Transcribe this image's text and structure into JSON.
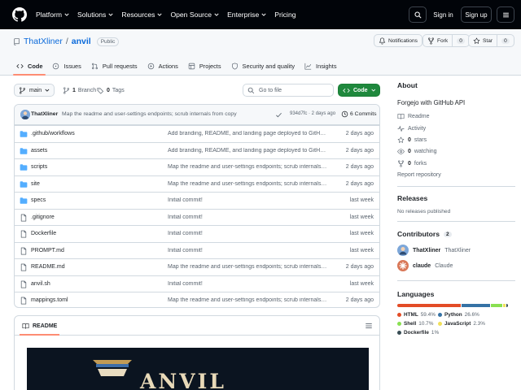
{
  "topbar": {
    "nav": [
      "Platform",
      "Solutions",
      "Resources",
      "Open Source",
      "Enterprise",
      "Pricing"
    ],
    "signin": "Sign in",
    "signup": "Sign up"
  },
  "repo": {
    "owner": "ThatXliner",
    "slash": "/",
    "name": "anvil",
    "visibility": "Public",
    "notifications": "Notifications",
    "fork_label": "Fork",
    "fork_count": "0",
    "star_label": "Star",
    "star_count": "0"
  },
  "tabs": [
    {
      "label": "Code",
      "icon": "code-icon"
    },
    {
      "label": "Issues",
      "icon": "issue-icon"
    },
    {
      "label": "Pull requests",
      "icon": "pull-request-icon"
    },
    {
      "label": "Actions",
      "icon": "play-icon"
    },
    {
      "label": "Projects",
      "icon": "table-icon"
    },
    {
      "label": "Security and quality",
      "icon": "shield-icon"
    },
    {
      "label": "Insights",
      "icon": "graph-icon"
    }
  ],
  "toolbar": {
    "branch": "main",
    "branch_count": "1",
    "branch_label": "Branch",
    "tag_count": "0",
    "tag_label": "Tags",
    "goto_placeholder": "Go to file",
    "code_button": "Code"
  },
  "commit": {
    "author": "ThatXliner",
    "message": "Map the readme and user-settings endpoints; scrub internals from copy",
    "hash": "934d7fc · 2 days ago",
    "count": "6 Commits"
  },
  "files": [
    {
      "type": "folder",
      "name": ".github/workflows",
      "message": "Add branding, README, and landing page deployed to GitHub Pages",
      "date": "2 days ago"
    },
    {
      "type": "folder",
      "name": "assets",
      "message": "Add branding, README, and landing page deployed to GitHub Pages",
      "date": "2 days ago"
    },
    {
      "type": "folder",
      "name": "scripts",
      "message": "Map the readme and user-settings endpoints; scrub internals from copy",
      "date": "2 days ago"
    },
    {
      "type": "folder",
      "name": "site",
      "message": "Map the readme and user-settings endpoints; scrub internals from copy",
      "date": "2 days ago"
    },
    {
      "type": "folder",
      "name": "specs",
      "message": "Initial commit!",
      "date": "last week"
    },
    {
      "type": "file",
      "name": ".gitignore",
      "message": "Initial commit!",
      "date": "last week"
    },
    {
      "type": "file",
      "name": "Dockerfile",
      "message": "Initial commit!",
      "date": "last week"
    },
    {
      "type": "file",
      "name": "PROMPT.md",
      "message": "Initial commit!",
      "date": "last week"
    },
    {
      "type": "file",
      "name": "README.md",
      "message": "Map the readme and user-settings endpoints; scrub internals from copy",
      "date": "2 days ago"
    },
    {
      "type": "file",
      "name": "anvil.sh",
      "message": "Initial commit!",
      "date": "last week"
    },
    {
      "type": "file",
      "name": "mappings.toml",
      "message": "Map the readme and user-settings endpoints; scrub internals from copy",
      "date": "2 days ago"
    }
  ],
  "readme": {
    "tab": "README",
    "banner_text": "ANVIL"
  },
  "about": {
    "heading": "About",
    "description": "Forgejo with GitHub API",
    "links": [
      {
        "icon": "book-icon",
        "label": "Readme"
      },
      {
        "icon": "pulse-icon",
        "label": "Activity"
      },
      {
        "icon": "star-icon",
        "count": "0",
        "label": "stars"
      },
      {
        "icon": "eye-icon",
        "count": "0",
        "label": "watching"
      },
      {
        "icon": "fork-icon",
        "count": "0",
        "label": "forks"
      }
    ],
    "report": "Report repository"
  },
  "releases": {
    "heading": "Releases",
    "text": "No releases published"
  },
  "contributors": {
    "heading": "Contributors",
    "count": "2",
    "people": [
      {
        "login": "ThatXliner",
        "name": "ThatXliner"
      },
      {
        "login": "claude",
        "name": "Claude"
      }
    ]
  },
  "languages": {
    "heading": "Languages",
    "items": [
      {
        "name": "HTML",
        "percent": "59.4%",
        "value": 59.4,
        "color": "#e34c26"
      },
      {
        "name": "Python",
        "percent": "26.6%",
        "value": 26.6,
        "color": "#3572a5"
      },
      {
        "name": "Shell",
        "percent": "10.7%",
        "value": 10.7,
        "color": "#89e051"
      },
      {
        "name": "JavaScript",
        "percent": "2.3%",
        "value": 2.3,
        "color": "#f1e05a"
      },
      {
        "name": "Dockerfile",
        "percent": "1%",
        "value": 1.0,
        "color": "#384d54"
      }
    ]
  }
}
